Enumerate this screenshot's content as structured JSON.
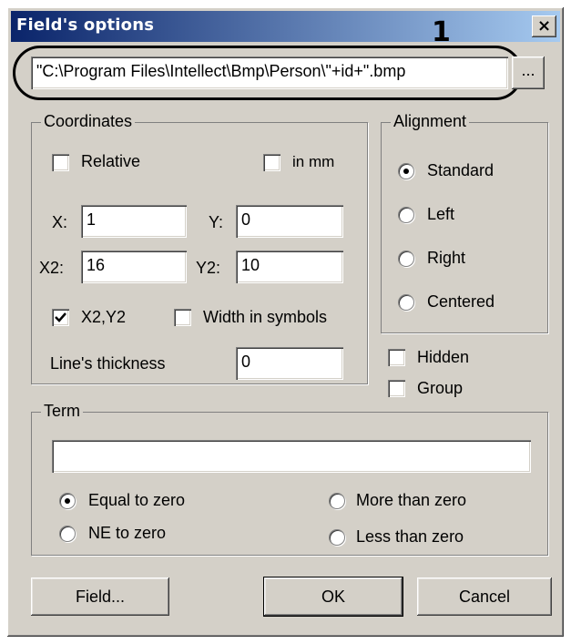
{
  "window": {
    "title": "Field's options",
    "marker": "1",
    "close_glyph": "×"
  },
  "path": {
    "value": "\"C:\\Program Files\\Intellect\\Bmp\\Person\\\"+id+\".bmp",
    "browse_label": "..."
  },
  "coordinates": {
    "title": "Coordinates",
    "relative_label": "Relative",
    "relative_checked": false,
    "inmm_label": "in mm",
    "inmm_checked": false,
    "x_label": "X:",
    "x_value": "1",
    "y_label": "Y:",
    "y_value": "0",
    "x2_label": "X2:",
    "x2_value": "16",
    "y2_label": "Y2:",
    "y2_value": "10",
    "x2y2_label": "X2,Y2",
    "x2y2_checked": true,
    "width_symbols_label": "Width in symbols",
    "width_symbols_checked": false,
    "thickness_label": "Line's thickness",
    "thickness_value": "0"
  },
  "alignment": {
    "title": "Alignment",
    "options": [
      "Standard",
      "Left",
      "Right",
      "Centered"
    ],
    "selected": "Standard"
  },
  "hidden": {
    "label": "Hidden",
    "checked": false
  },
  "group_opt": {
    "label": "Group",
    "checked": false
  },
  "term": {
    "title": "Term",
    "value": "",
    "equal_label": "Equal to zero",
    "more_label": "More than zero",
    "ne_label": "NE to zero",
    "less_label": "Less than zero",
    "selected": "Equal to zero"
  },
  "buttons": {
    "field": "Field...",
    "ok": "OK",
    "cancel": "Cancel"
  },
  "icons": {
    "close": "close-icon",
    "check": "check-icon",
    "radio_dot": "radio-dot-icon"
  }
}
